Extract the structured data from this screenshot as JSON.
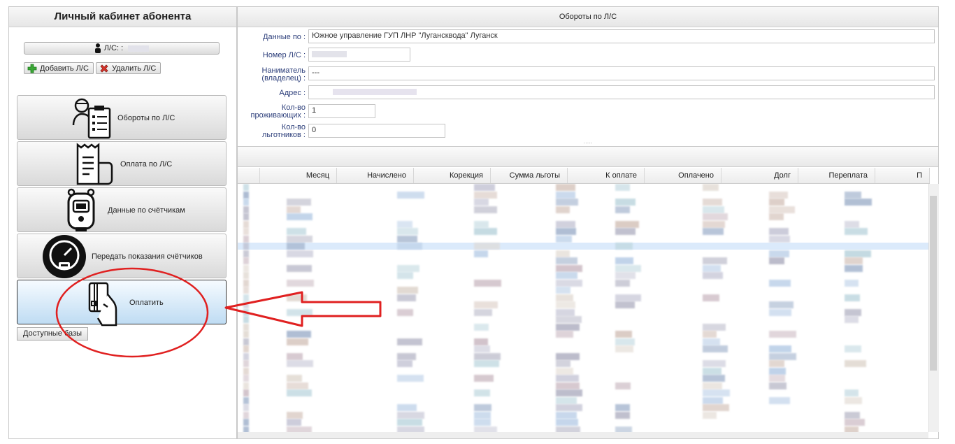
{
  "left": {
    "title": "Личный кабинет абонента",
    "account_label": "Л/С: :",
    "add_label": "Добавить Л/С",
    "delete_label": "Удалить Л/С",
    "menu": [
      {
        "label": "Обороты по Л/С",
        "icon": "clipboard-person-icon"
      },
      {
        "label": "Оплата по Л/С",
        "icon": "receipt-icon"
      },
      {
        "label": "Данные по счётчикам",
        "icon": "meter-device-icon"
      },
      {
        "label": "Передать показания счётчиков",
        "icon": "gauge-icon"
      },
      {
        "label": "Оплатить",
        "icon": "card-hand-icon"
      }
    ],
    "available_label": "Доступные базы"
  },
  "right": {
    "title": "Обороты по Л/С",
    "fields": {
      "data_label": "Данные по :",
      "data_value": "Южное управление  ГУП ЛНР  \"Луганскводa\" Луганск",
      "account_label": "Номер Л/С :",
      "owner_label1": "Наниматель",
      "owner_label2": "(владелец) :",
      "owner_value": "---",
      "address_label": "Адрес :",
      "residents_label1": "Кол-во",
      "residents_label2": "проживающих :",
      "residents_value": "1",
      "benefit_label1": "Кол-во",
      "benefit_label2": "льготников :",
      "benefit_value": "0"
    },
    "columns": [
      "Месяц",
      "Начислено",
      "Корекция",
      "Сумма льготы",
      "К оплате",
      "Оплачено",
      "Долг",
      "Переплата",
      "П"
    ]
  },
  "colors": {
    "active_button": "#bfdcf3",
    "annotation": "#e02020",
    "row_highlight": "#dbeafb"
  }
}
